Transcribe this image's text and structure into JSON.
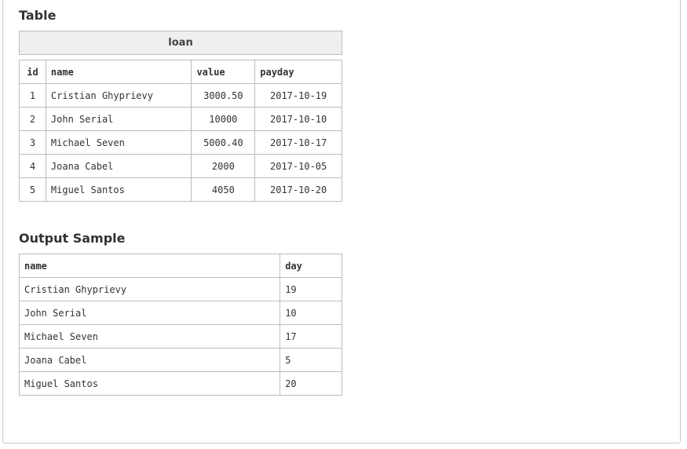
{
  "sections": {
    "table_title": "Table",
    "output_title": "Output Sample"
  },
  "loan": {
    "caption": "loan",
    "headers": {
      "id": "id",
      "name": "name",
      "value": "value",
      "payday": "payday"
    },
    "rows": [
      {
        "id": "1",
        "name": "Cristian Ghyprievy",
        "value": "3000.50",
        "payday": "2017-10-19"
      },
      {
        "id": "2",
        "name": "John Serial",
        "value": "10000",
        "payday": "2017-10-10"
      },
      {
        "id": "3",
        "name": "Michael Seven",
        "value": "5000.40",
        "payday": "2017-10-17"
      },
      {
        "id": "4",
        "name": "Joana Cabel",
        "value": "2000",
        "payday": "2017-10-05"
      },
      {
        "id": "5",
        "name": "Miguel Santos",
        "value": "4050",
        "payday": "2017-10-20"
      }
    ]
  },
  "output": {
    "headers": {
      "name": "name",
      "day": "day"
    },
    "rows": [
      {
        "name": "Cristian Ghyprievy",
        "day": "19"
      },
      {
        "name": "John Serial",
        "day": "10"
      },
      {
        "name": "Michael Seven",
        "day": "17"
      },
      {
        "name": "Joana Cabel",
        "day": "5"
      },
      {
        "name": "Miguel Santos",
        "day": "20"
      }
    ]
  }
}
